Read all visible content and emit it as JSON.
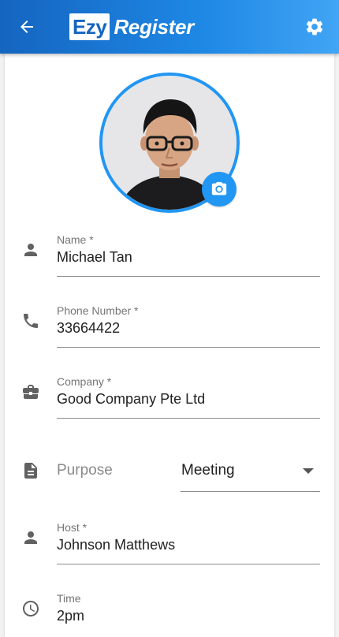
{
  "app_bar": {
    "logo_box_text": "Ezy",
    "logo_text": "Register",
    "back_icon": "arrow-back-icon",
    "settings_icon": "gear-icon",
    "colors": {
      "start": "#1565c0",
      "end": "#42a5f5"
    }
  },
  "profile": {
    "avatar": "person-photo",
    "camera_icon": "camera-icon",
    "accent": "#2196f3"
  },
  "form": {
    "name": {
      "label": "Name *",
      "value": "Michael Tan",
      "icon": "person-icon"
    },
    "phone": {
      "label": "Phone Number *",
      "value": "33664422",
      "icon": "phone-icon"
    },
    "company": {
      "label": "Company *",
      "value": "Good Company Pte Ltd",
      "icon": "briefcase-icon"
    },
    "purpose": {
      "label": "Purpose",
      "value": "Meeting",
      "icon": "document-icon"
    },
    "host": {
      "label": "Host *",
      "value": "Johnson Matthews",
      "icon": "person-icon"
    },
    "time": {
      "label": "Time",
      "value": "2pm",
      "icon": "clock-icon"
    }
  }
}
